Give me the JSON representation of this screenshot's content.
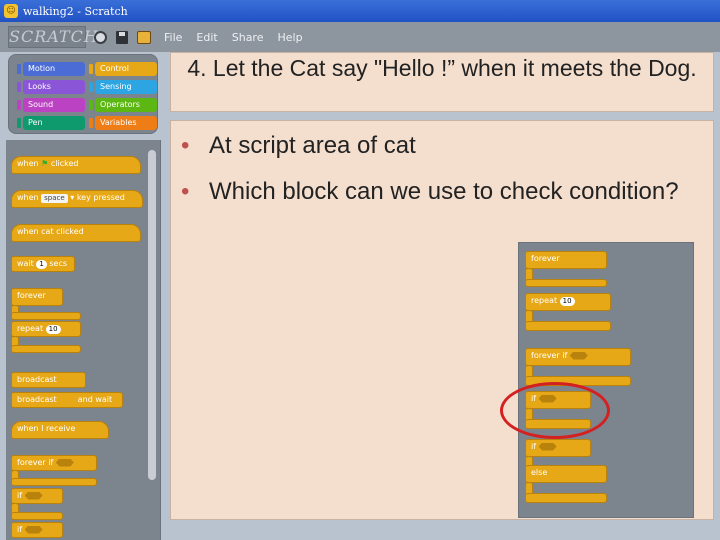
{
  "window": {
    "title": "walking2 - Scratch"
  },
  "menu": {
    "logo_text": "SCRATCH",
    "items": [
      "File",
      "Edit",
      "Share",
      "Help"
    ]
  },
  "categories": [
    {
      "label": "Motion",
      "color": "#4a6cd4"
    },
    {
      "label": "Control",
      "color": "#e6a816"
    },
    {
      "label": "Looks",
      "color": "#8a55d7"
    },
    {
      "label": "Sensing",
      "color": "#2ca5e2"
    },
    {
      "label": "Sound",
      "color": "#bb42c3"
    },
    {
      "label": "Operators",
      "color": "#5cb712"
    },
    {
      "label": "Pen",
      "color": "#0e9a6c"
    },
    {
      "label": "Variables",
      "color": "#ee7d16"
    }
  ],
  "palette": {
    "when_flag": "when",
    "clicked": "clicked",
    "when_key": "when",
    "key_value": "space",
    "key_pressed": "key pressed",
    "when_sprite": "when cat clicked",
    "wait": "wait",
    "wait_value": "1",
    "wait_secs": "secs",
    "forever": "forever",
    "repeat": "repeat",
    "repeat_value": "10",
    "broadcast": "broadcast",
    "broadcast_wait": "broadcast",
    "and_wait": "and wait",
    "when_receive": "when I receive",
    "forever_if": "forever if",
    "if1": "if",
    "if2": "if"
  },
  "slide": {
    "title": "4. Let the Cat say \"Hello !” when it meets the Dog.",
    "bullets": [
      "At script area of cat",
      "Which block can we use to check condition?"
    ]
  },
  "inset": {
    "forever": "forever",
    "repeat": "repeat",
    "repeat_value": "10",
    "forever_if": "forever if",
    "if": "if",
    "if_else": "if",
    "else": "else"
  }
}
